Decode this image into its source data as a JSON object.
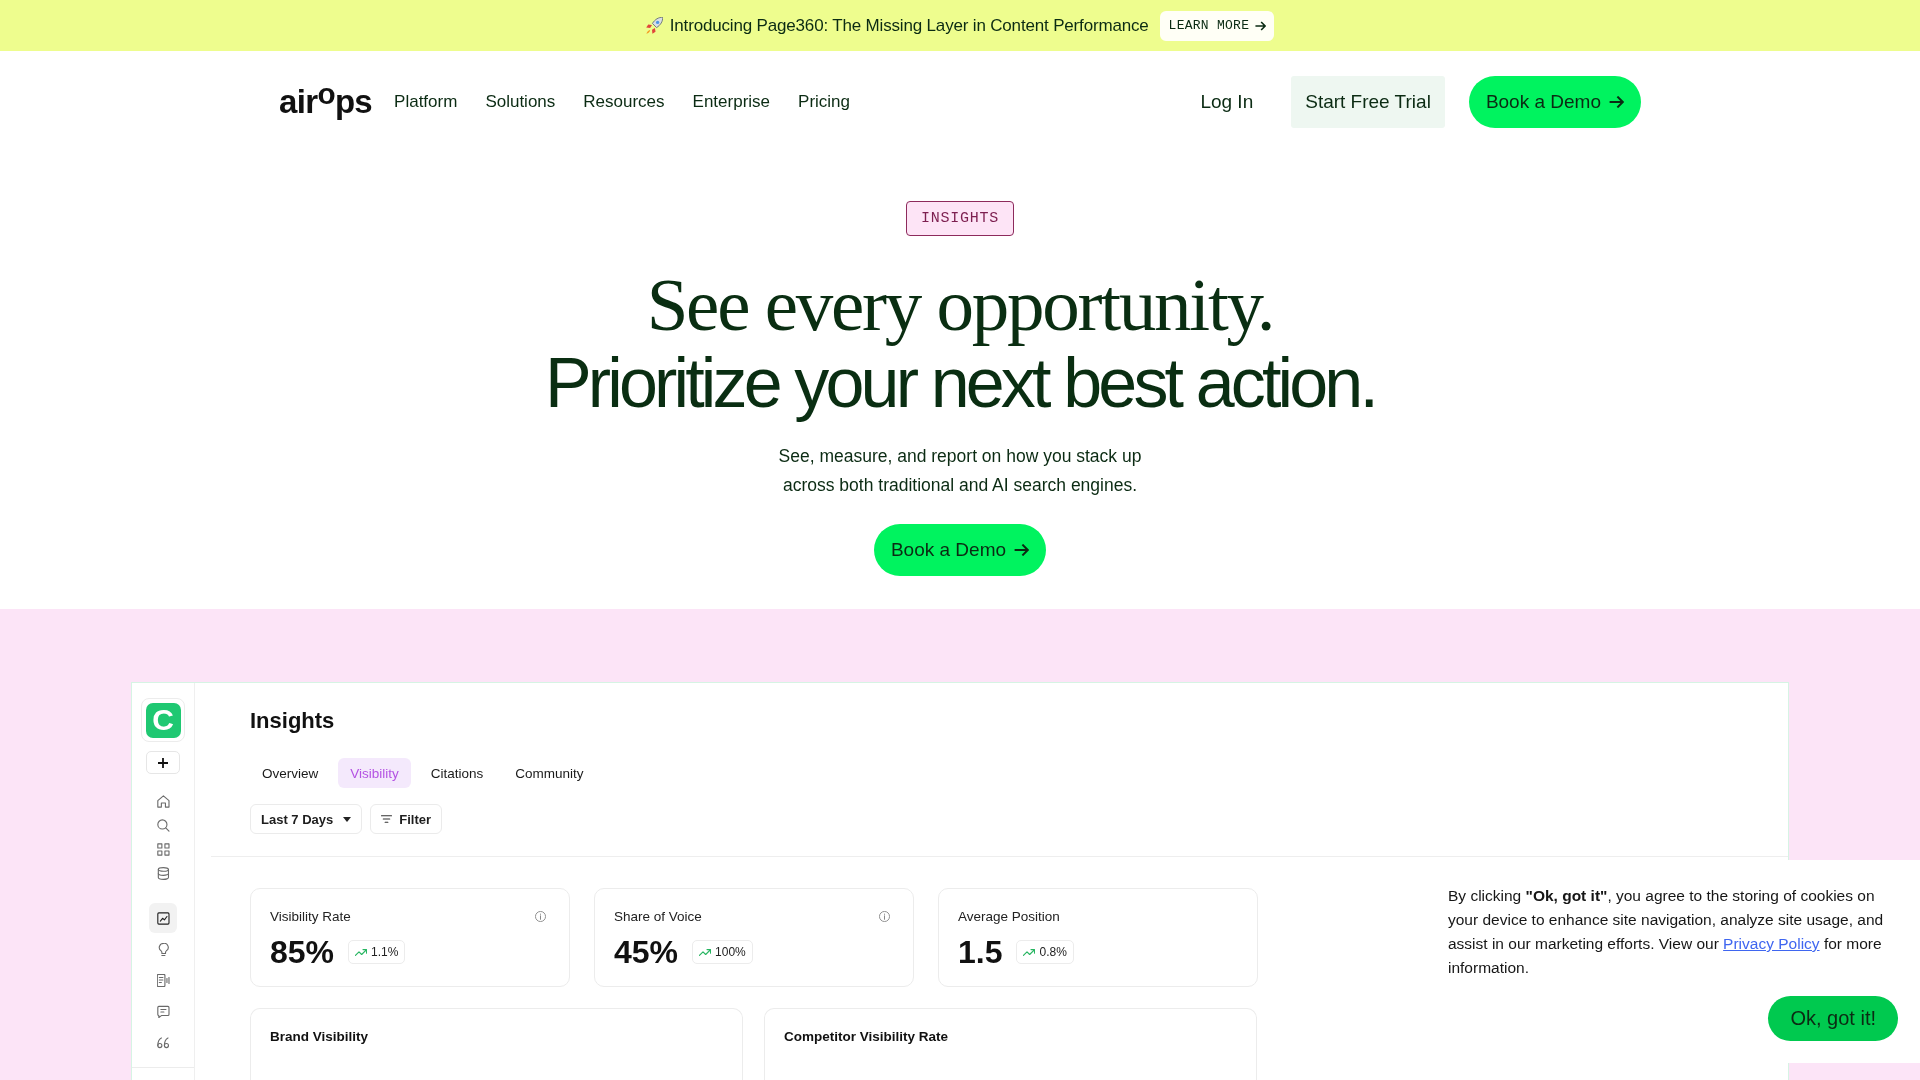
{
  "announcement": {
    "text": "Introducing Page360: The Missing Layer in Content Performance",
    "button": "LEARN MORE"
  },
  "nav": {
    "logo": "air$^{o}$ps",
    "links": [
      "Platform",
      "Solutions",
      "Resources",
      "Enterprise",
      "Pricing"
    ],
    "login": "Log In",
    "trial_button": "Start Free Trial",
    "demo_button": "Book a Demo"
  },
  "hero": {
    "badge": "INSIGHTS",
    "headline": [
      {
        "text": "See every opportunity.",
        "kind": "serif"
      },
      {
        "text": "Prioritize your next best action.",
        "kind": "sans"
      }
    ],
    "subtitle": "See, measure, and report on how you stack up across both traditional and AI search engines.",
    "cta": "Book a Demo"
  },
  "dashboard": {
    "app_logo": "C",
    "sidebar_groups": [
      [
        {
          "selected": false
        },
        {
          "selected": false
        },
        {
          "selected": false
        },
        {
          "selected": false
        }
      ],
      [
        {
          "selected": true
        },
        {
          "selected": false
        },
        {
          "selected": false
        },
        {
          "selected": false
        },
        {
          "selected": false
        }
      ]
    ],
    "title": "Insights",
    "tabs": [
      {
        "label": "Overview",
        "selected": false
      },
      {
        "label": "Visibility",
        "selected": true
      },
      {
        "label": "Citations",
        "selected": false
      },
      {
        "label": "Community",
        "selected": false
      }
    ],
    "date_range": "Last 7 Days",
    "filter_button": "Filter",
    "stats": [
      {
        "label": "Visibility Rate",
        "value": "85%",
        "change": "1.1%",
        "info": true
      },
      {
        "label": "Share of Voice",
        "value": "45%",
        "change": "100%",
        "info": true
      },
      {
        "label": "Average Position",
        "value": "1.5",
        "change": "0.8%",
        "info": false
      }
    ],
    "panels": [
      {
        "title": "Brand Visibility"
      },
      {
        "title": "Competitor Visibility Rate"
      }
    ]
  },
  "cookie_notice": {
    "text": "By clicking **\"Ok, got it\"**, you agree to the storing of cookies on your device to enhance site navigation, analyze site usage, and assist in our marketing efforts. View our",
    "link": "Privacy Policy",
    "text_after": "for more information.",
    "button": "Ok, got it!"
  }
}
